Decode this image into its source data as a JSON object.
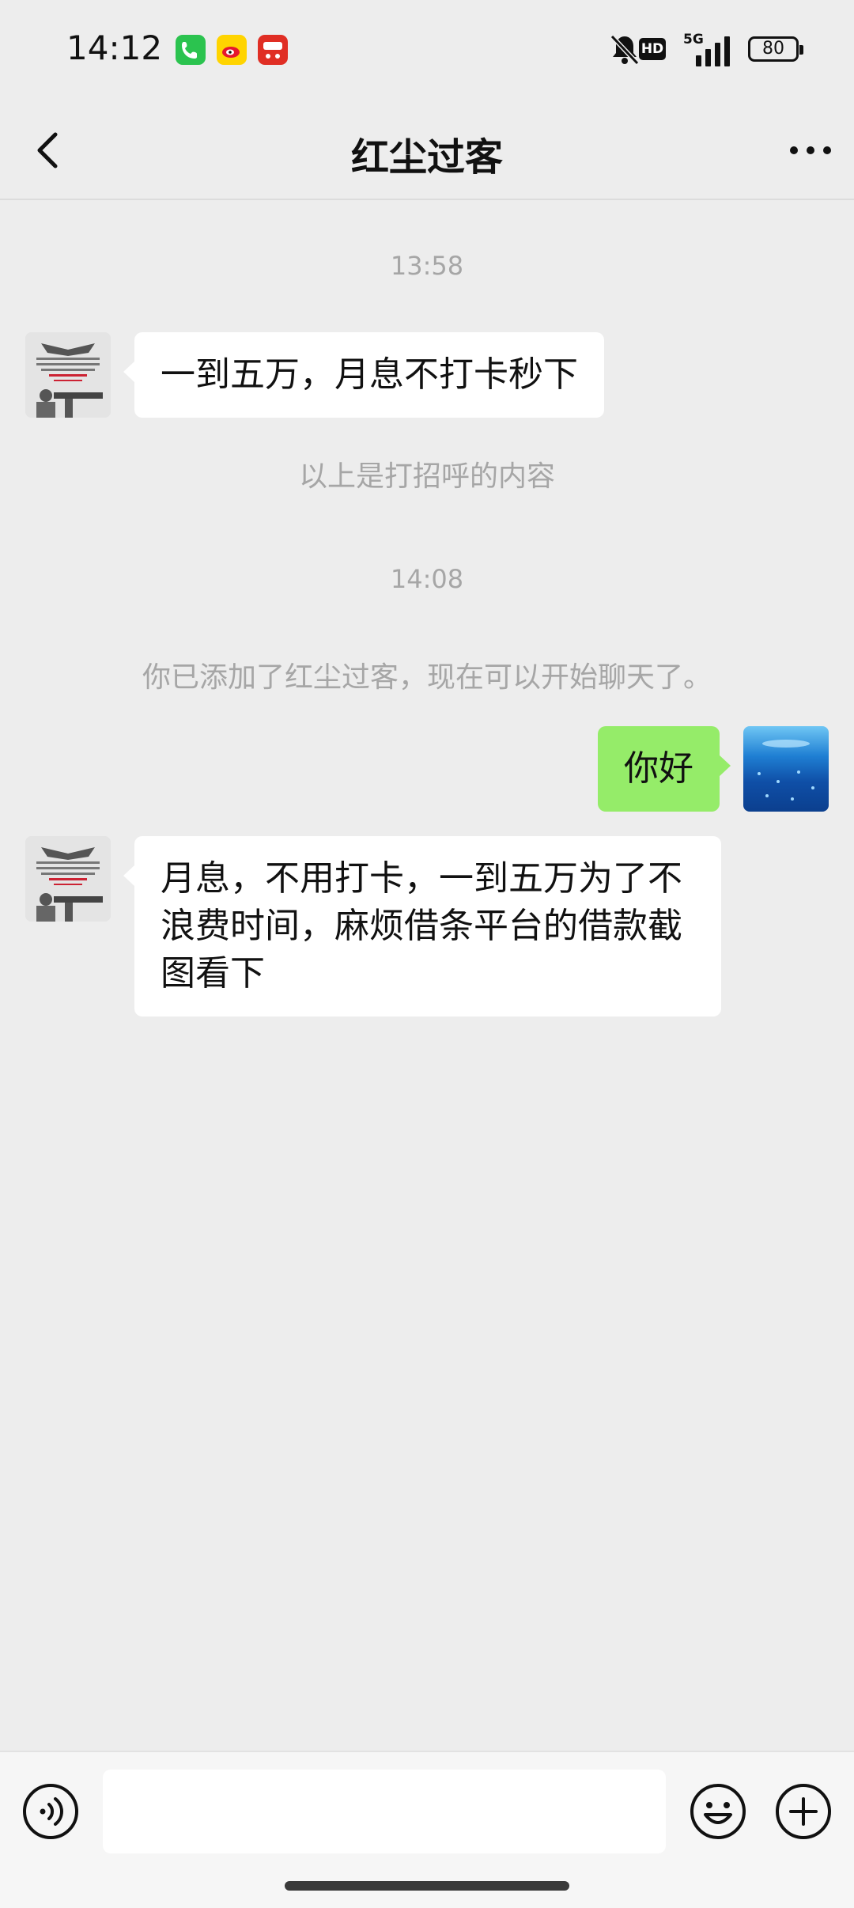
{
  "status_bar": {
    "time": "14:12",
    "apps": [
      "phone-icon",
      "weibo-icon",
      "pinduoduo-icon"
    ],
    "network": "5G",
    "hd_label": "HD",
    "battery": "80"
  },
  "header": {
    "title": "红尘过客",
    "back_icon": "chevron-left-icon",
    "more_icon": "more-dots-icon"
  },
  "chat": {
    "time_1": "13:58",
    "msg_1": "一到五万，月息不打卡秒下",
    "note_greeting": "以上是打招呼的内容",
    "time_2": "14:08",
    "note_added": "你已添加了红尘过客，现在可以开始聊天了。",
    "msg_2": "你好",
    "msg_3_line1": "月息，不用打卡，一到五万为了不",
    "msg_3_line2": "浪费时间，麻烦借条平台的借款截",
    "msg_3_line3": "图看下"
  },
  "input_bar": {
    "voice_icon": "voice-icon",
    "text_value": "",
    "emoji_icon": "emoji-icon",
    "plus_icon": "plus-icon"
  },
  "colors": {
    "background": "#ededed",
    "incoming_bubble": "#ffffff",
    "outgoing_bubble": "#95ec69",
    "meta_text": "#a6a6a6"
  }
}
